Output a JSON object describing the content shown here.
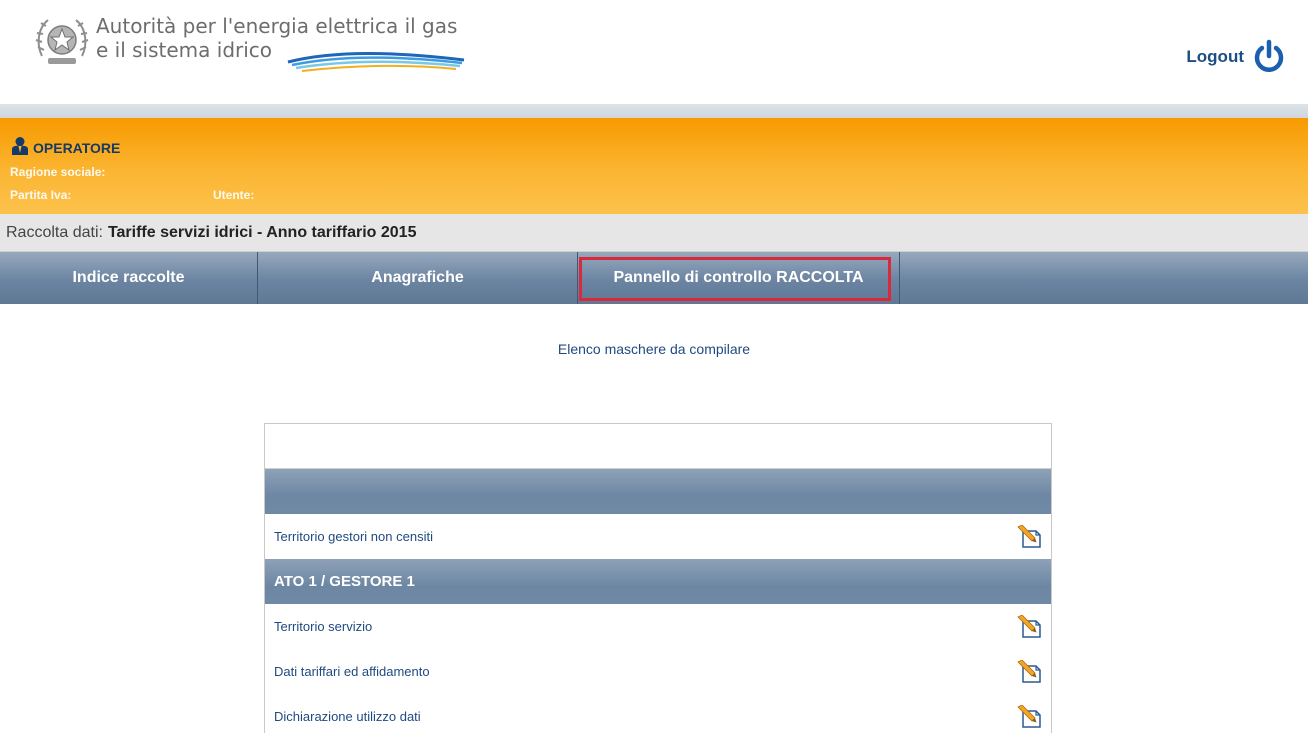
{
  "header": {
    "logo_line1": "Autorità per l'energia elettrica il gas",
    "logo_line2": "e il sistema idrico",
    "logout_label": "Logout",
    "icons": {
      "emblem": "italian-republic-emblem",
      "logout": "power-icon"
    }
  },
  "operator": {
    "title": "OPERATORE",
    "ragione_sociale_label": "Ragione sociale:",
    "partita_iva_label": "Partita Iva:",
    "utente_label": "Utente:",
    "icon": "user-icon"
  },
  "raccolta": {
    "prefix": "Raccolta dati:",
    "name": "Tariffe servizi idrici - Anno tariffario 2015"
  },
  "nav": {
    "tabs": [
      {
        "label": "Indice raccolte"
      },
      {
        "label": "Anagrafiche"
      },
      {
        "label": "Pannello di controllo RACCOLTA",
        "highlighted": true
      }
    ]
  },
  "content": {
    "caption": "Elenco maschere da compilare",
    "rows": [
      {
        "type": "blank"
      },
      {
        "type": "section",
        "label": ""
      },
      {
        "type": "item",
        "label": "Territorio gestori non censiti",
        "icon": "edit-icon"
      },
      {
        "type": "section",
        "label": "ATO 1 / GESTORE 1"
      },
      {
        "type": "item",
        "label": "Territorio servizio",
        "icon": "edit-icon"
      },
      {
        "type": "item",
        "label": "Dati tariffari ed affidamento",
        "icon": "edit-icon"
      },
      {
        "type": "item",
        "label": "Dichiarazione utilizzo dati",
        "icon": "edit-icon"
      }
    ]
  },
  "colors": {
    "orange_band": "#fbb532",
    "nav_blue": "#6b84a1",
    "link_blue": "#1f4a80",
    "highlight_red": "#d9293a"
  }
}
